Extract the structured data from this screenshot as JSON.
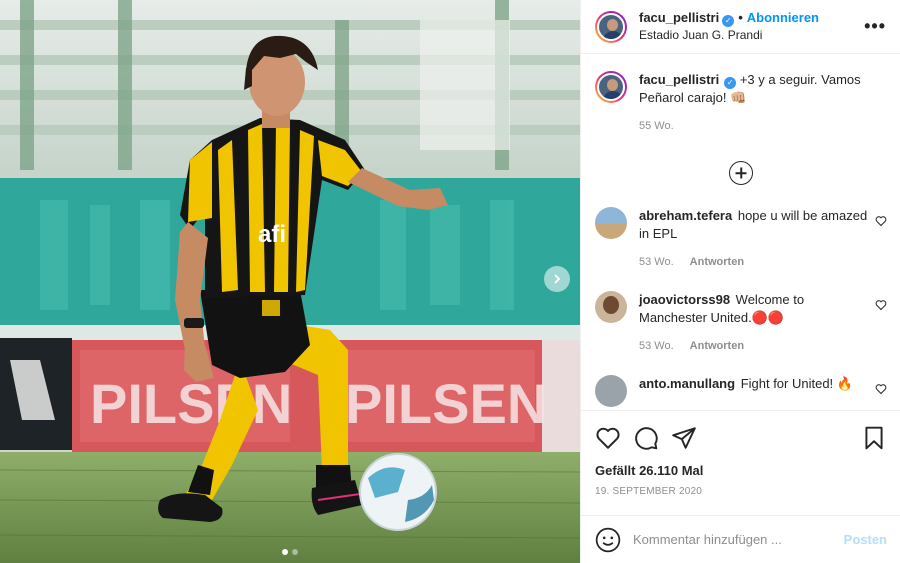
{
  "post": {
    "author": "facu_pellistri",
    "verified": true,
    "follow_label": "Abonnieren",
    "separator": "•",
    "location": "Estadio Juan G. Prandi",
    "more_label": "•••"
  },
  "photo": {
    "banner_text_1": "PILSEN",
    "banner_text_2": "PILSEN",
    "sponsor_text": "afi",
    "slides": 2,
    "active_slide": 1
  },
  "caption": {
    "username": "facu_pellistri",
    "text": "+3 y a seguir. Vamos Peñarol carajo! 👊🏼",
    "time": "55 Wo."
  },
  "comments": [
    {
      "username": "abreham.tefera",
      "text": "hope u will be amazed in EPL",
      "time": "53 Wo.",
      "reply_label": "Antworten"
    },
    {
      "username": "joaovictorss98",
      "text": "Welcome to Manchester United.🔴🔴",
      "time": "53 Wo.",
      "reply_label": "Antworten"
    },
    {
      "username": "anto.manullang",
      "text": "Fight for United! 🔥",
      "time": "",
      "reply_label": ""
    }
  ],
  "actions": {
    "likes": "Gefällt 26.110 Mal",
    "date": "19. SEPTEMBER 2020"
  },
  "composer": {
    "placeholder": "Kommentar hinzufügen ...",
    "post_label": "Posten"
  },
  "colors": {
    "accent": "#0095f6",
    "verified": "#3897f0",
    "muted": "#8e8e8e",
    "kit_yellow": "#f2c200"
  }
}
